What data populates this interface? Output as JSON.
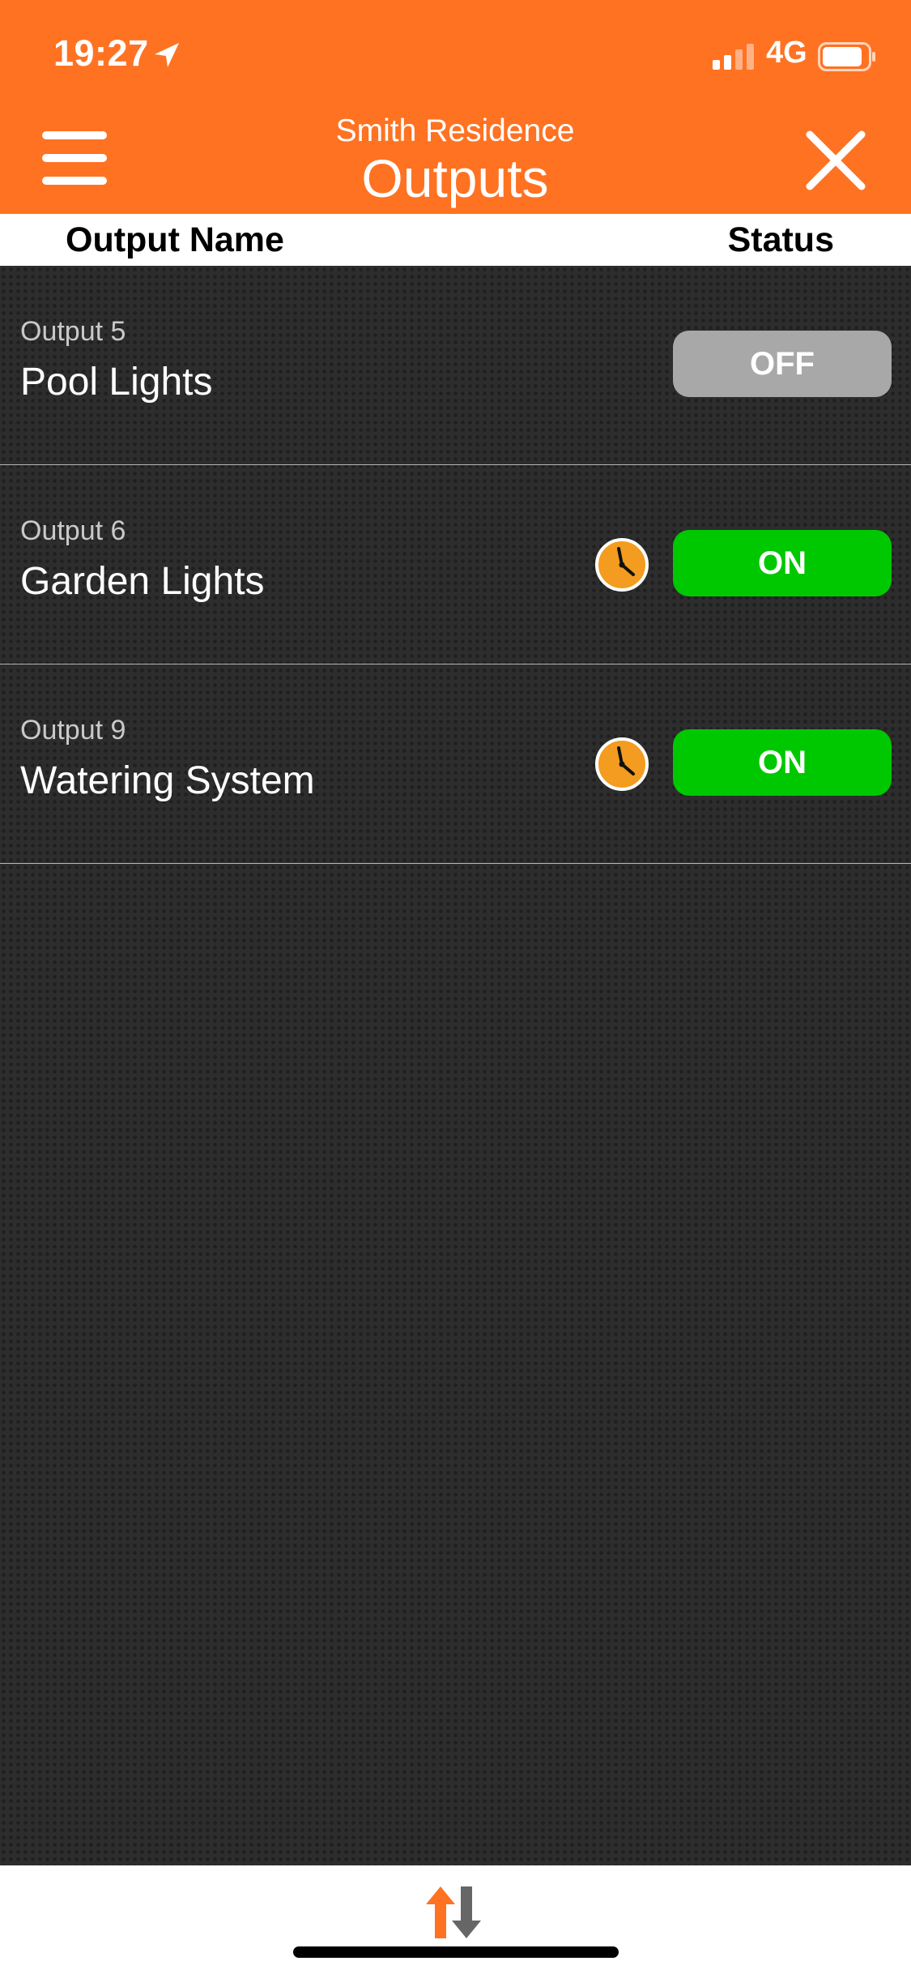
{
  "status_bar": {
    "time": "19:27",
    "network": "4G",
    "location_icon": "location-arrow-icon",
    "signal_icon": "cellular-signal-icon",
    "battery_icon": "battery-icon"
  },
  "nav": {
    "site_name": "Smith Residence",
    "title": "Outputs",
    "menu_icon": "hamburger-menu-icon",
    "close_icon": "close-icon"
  },
  "columns": {
    "name": "Output Name",
    "status": "Status"
  },
  "outputs": [
    {
      "id_label": "Output 5",
      "name": "Pool Lights",
      "status": "OFF",
      "scheduled": false
    },
    {
      "id_label": "Output 6",
      "name": "Garden Lights",
      "status": "ON",
      "scheduled": true
    },
    {
      "id_label": "Output 9",
      "name": "Watering System",
      "status": "ON",
      "scheduled": true
    }
  ],
  "bottom": {
    "sync_icon": "sync-arrows-icon"
  },
  "colors": {
    "accent": "#ff7222",
    "on": "#00c800",
    "off": "#a8a8a8",
    "schedule": "#f39c1f",
    "background": "#2d2d2d"
  }
}
